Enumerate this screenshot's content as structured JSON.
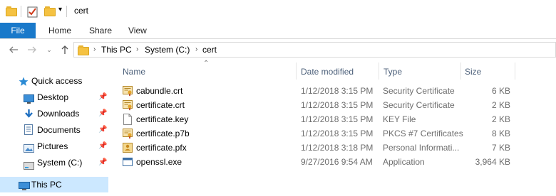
{
  "window": {
    "title": "cert"
  },
  "ribbon": {
    "tabs": [
      "File",
      "Home",
      "Share",
      "View"
    ]
  },
  "breadcrumb": [
    "This PC",
    "System (C:)",
    "cert"
  ],
  "sidebar": {
    "items": [
      {
        "label": "Quick access",
        "icon": "star-icon",
        "pinned": false
      },
      {
        "label": "Desktop",
        "icon": "desktop-icon",
        "pinned": true
      },
      {
        "label": "Downloads",
        "icon": "download-icon",
        "pinned": true
      },
      {
        "label": "Documents",
        "icon": "documents-icon",
        "pinned": true
      },
      {
        "label": "Pictures",
        "icon": "pictures-icon",
        "pinned": true
      },
      {
        "label": "System (C:)",
        "icon": "drive-icon",
        "pinned": true
      },
      {
        "label": "This PC",
        "icon": "computer-icon",
        "pinned": false
      }
    ]
  },
  "columns": {
    "name": "Name",
    "date": "Date modified",
    "type": "Type",
    "size": "Size"
  },
  "files": [
    {
      "name": "cabundle.crt",
      "date": "1/12/2018 3:15 PM",
      "type": "Security Certificate",
      "size": "6 KB",
      "icon": "certificate-icon"
    },
    {
      "name": "certificate.crt",
      "date": "1/12/2018 3:15 PM",
      "type": "Security Certificate",
      "size": "2 KB",
      "icon": "certificate-icon"
    },
    {
      "name": "certificate.key",
      "date": "1/12/2018 3:15 PM",
      "type": "KEY File",
      "size": "2 KB",
      "icon": "file-icon"
    },
    {
      "name": "certificate.p7b",
      "date": "1/12/2018 3:15 PM",
      "type": "PKCS #7 Certificates",
      "size": "8 KB",
      "icon": "certificate-icon"
    },
    {
      "name": "certificate.pfx",
      "date": "1/12/2018 3:18 PM",
      "type": "Personal Informati...",
      "size": "7 KB",
      "icon": "personal-info-icon"
    },
    {
      "name": "openssl.exe",
      "date": "9/27/2016 9:54 AM",
      "type": "Application",
      "size": "3,964 KB",
      "icon": "application-icon"
    }
  ],
  "colors": {
    "accent": "#1979ca",
    "selected": "#cce8ff",
    "folder": "#f5c242"
  }
}
